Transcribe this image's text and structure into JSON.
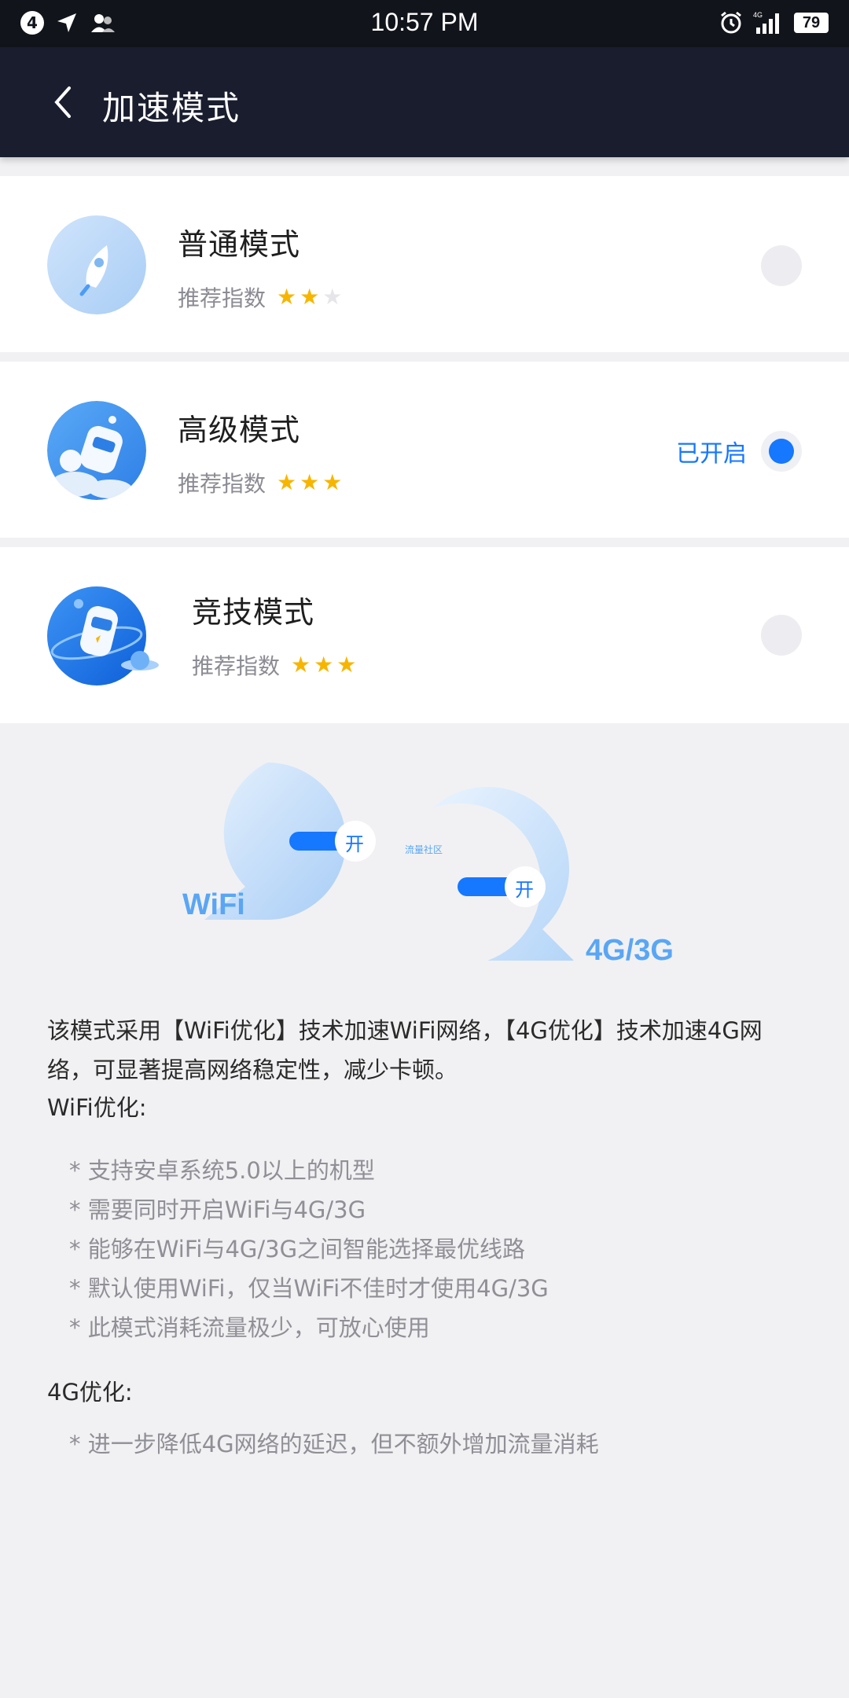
{
  "status_bar": {
    "notification_count": "4",
    "time": "10:57 PM",
    "network_type": "4G",
    "battery": "79"
  },
  "header": {
    "title": "加速模式"
  },
  "modes": [
    {
      "name": "普通模式",
      "rating_label": "推荐指数",
      "stars": 2,
      "max_stars": 3,
      "selected": false,
      "status": ""
    },
    {
      "name": "高级模式",
      "rating_label": "推荐指数",
      "stars": 3,
      "max_stars": 3,
      "selected": true,
      "status": "已开启"
    },
    {
      "name": "竞技模式",
      "rating_label": "推荐指数",
      "stars": 3,
      "max_stars": 3,
      "selected": false,
      "status": ""
    }
  ],
  "illustration": {
    "wifi_label": "WiFi",
    "mobile_label": "4G/3G",
    "toggle_text": "开",
    "watermark": "流量社区"
  },
  "description": {
    "intro": "该模式采用【WiFi优化】技术加速WiFi网络，【4G优化】技术加速4G网络，可显著提高网络稳定性，减少卡顿。",
    "wifi_title": "WiFi优化:",
    "wifi_items": [
      "支持安卓系统5.0以上的机型",
      "需要同时开启WiFi与4G/3G",
      "能够在WiFi与4G/3G之间智能选择最优线路",
      "默认使用WiFi，仅当WiFi不佳时才使用4G/3G",
      "此模式消耗流量极少，可放心使用"
    ],
    "g4_title": "4G优化:",
    "g4_items": [
      "进一步降低4G网络的延迟，但不额外增加流量消耗"
    ]
  },
  "colors": {
    "accent": "#1677ff",
    "star": "#f7b500",
    "header_bg": "#1a1d2e",
    "status_bar_bg": "#12141c"
  }
}
